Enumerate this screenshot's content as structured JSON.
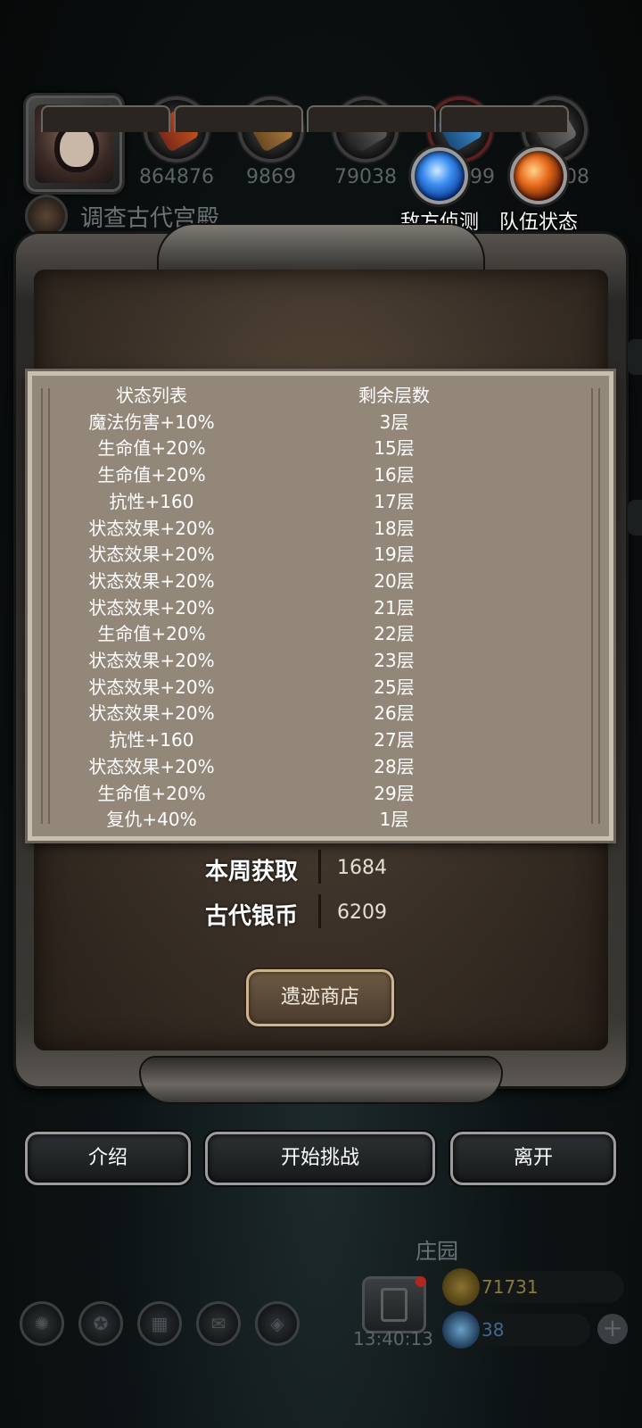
{
  "resources": [
    {
      "icon": "meat-icon",
      "value": "864876"
    },
    {
      "icon": "wood-icon",
      "value": "9869"
    },
    {
      "icon": "iron-icon",
      "value": "79038"
    },
    {
      "icon": "crystal-icon",
      "value": "499"
    },
    {
      "icon": "stone-icon",
      "value": "08"
    }
  ],
  "quest": {
    "title": "调查古代宫殿"
  },
  "top_buttons": {
    "enemy_scout": "敌方侦测",
    "team_status": "队伍状态"
  },
  "status_popup": {
    "header": {
      "name": "状态列表",
      "layers": "剩余层数"
    },
    "rows": [
      {
        "name": "魔法伤害+10%",
        "layers": "3层"
      },
      {
        "name": "生命值+20%",
        "layers": "15层"
      },
      {
        "name": "生命值+20%",
        "layers": "16层"
      },
      {
        "name": "抗性+160",
        "layers": "17层"
      },
      {
        "name": "状态效果+20%",
        "layers": "18层"
      },
      {
        "name": "状态效果+20%",
        "layers": "19层"
      },
      {
        "name": "状态效果+20%",
        "layers": "20层"
      },
      {
        "name": "状态效果+20%",
        "layers": "21层"
      },
      {
        "name": "生命值+20%",
        "layers": "22层"
      },
      {
        "name": "状态效果+20%",
        "layers": "23层"
      },
      {
        "name": "状态效果+20%",
        "layers": "25层"
      },
      {
        "name": "状态效果+20%",
        "layers": "26层"
      },
      {
        "name": "抗性+160",
        "layers": "27层"
      },
      {
        "name": "状态效果+20%",
        "layers": "28层"
      },
      {
        "name": "生命值+20%",
        "layers": "29层"
      },
      {
        "name": "复仇+40%",
        "layers": "1层"
      }
    ]
  },
  "panel": {
    "weekly_label": "本周获取",
    "weekly_value": "1684",
    "coins_label": "古代银币",
    "coins_value": "6209",
    "shop_button": "遗迹商店"
  },
  "actions": {
    "intro": "介绍",
    "start": "开始挑战",
    "leave": "离开"
  },
  "hud": {
    "manor": "庄园",
    "timer": "13:40:13",
    "gold": "71731",
    "gems": "38",
    "gold_color": "#8a7a3c",
    "gem_color": "#3f6a8f"
  }
}
